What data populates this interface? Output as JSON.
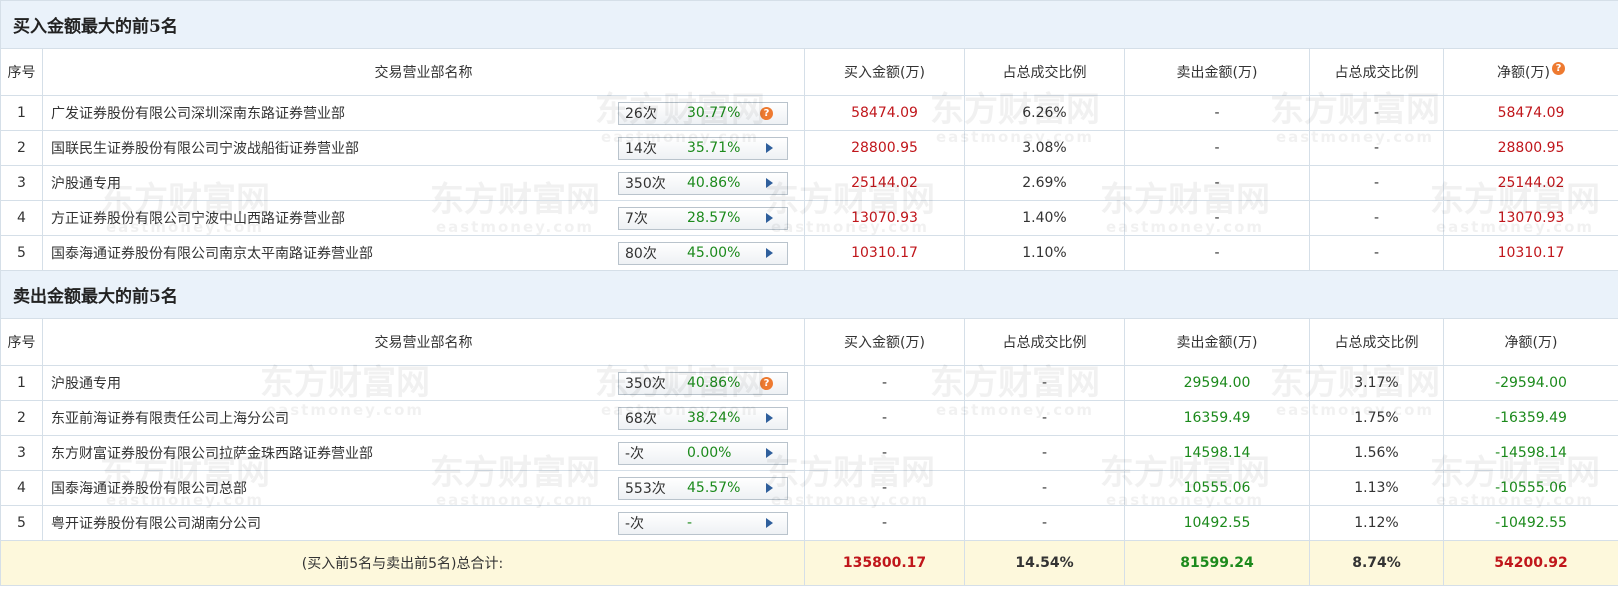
{
  "buy_section": {
    "title": "买入金额最大的前5名",
    "rows": [
      {
        "idx": "1",
        "name": "广发证券股份有限公司深圳深南东路证券营业部",
        "count": "26次",
        "pct": "30.77%",
        "buy": "58474.09",
        "buy_ratio": "6.26%",
        "sell": "-",
        "sell_ratio": "-",
        "net": "58474.09"
      },
      {
        "idx": "2",
        "name": "国联民生证券股份有限公司宁波战船街证券营业部",
        "count": "14次",
        "pct": "35.71%",
        "buy": "28800.95",
        "buy_ratio": "3.08%",
        "sell": "-",
        "sell_ratio": "-",
        "net": "28800.95"
      },
      {
        "idx": "3",
        "name": "沪股通专用",
        "count": "350次",
        "pct": "40.86%",
        "buy": "25144.02",
        "buy_ratio": "2.69%",
        "sell": "-",
        "sell_ratio": "-",
        "net": "25144.02"
      },
      {
        "idx": "4",
        "name": "方正证券股份有限公司宁波中山西路证券营业部",
        "count": "7次",
        "pct": "28.57%",
        "buy": "13070.93",
        "buy_ratio": "1.40%",
        "sell": "-",
        "sell_ratio": "-",
        "net": "13070.93"
      },
      {
        "idx": "5",
        "name": "国泰海通证券股份有限公司南京太平南路证券营业部",
        "count": "80次",
        "pct": "45.00%",
        "buy": "10310.17",
        "buy_ratio": "1.10%",
        "sell": "-",
        "sell_ratio": "-",
        "net": "10310.17"
      }
    ]
  },
  "sell_section": {
    "title": "卖出金额最大的前5名",
    "rows": [
      {
        "idx": "1",
        "name": "沪股通专用",
        "count": "350次",
        "pct": "40.86%",
        "buy": "-",
        "buy_ratio": "-",
        "sell": "29594.00",
        "sell_ratio": "3.17%",
        "net": "-29594.00"
      },
      {
        "idx": "2",
        "name": "东亚前海证券有限责任公司上海分公司",
        "count": "68次",
        "pct": "38.24%",
        "buy": "-",
        "buy_ratio": "-",
        "sell": "16359.49",
        "sell_ratio": "1.75%",
        "net": "-16359.49"
      },
      {
        "idx": "3",
        "name": "东方财富证券股份有限公司拉萨金珠西路证券营业部",
        "count": "-次",
        "pct": "0.00%",
        "buy": "-",
        "buy_ratio": "-",
        "sell": "14598.14",
        "sell_ratio": "1.56%",
        "net": "-14598.14"
      },
      {
        "idx": "4",
        "name": "国泰海通证券股份有限公司总部",
        "count": "553次",
        "pct": "45.57%",
        "buy": "-",
        "buy_ratio": "-",
        "sell": "10555.06",
        "sell_ratio": "1.13%",
        "net": "-10555.06"
      },
      {
        "idx": "5",
        "name": "粤开证券股份有限公司湖南分公司",
        "count": "-次",
        "pct": "-",
        "buy": "-",
        "buy_ratio": "-",
        "sell": "10492.55",
        "sell_ratio": "1.12%",
        "net": "-10492.55"
      }
    ]
  },
  "headers": {
    "idx": "序号",
    "name": "交易营业部名称",
    "buy": "买入金额(万)",
    "buy_ratio": "占总成交比例",
    "sell": "卖出金额(万)",
    "sell_ratio": "占总成交比例",
    "net": "净额(万)"
  },
  "help_icon_glyph": "?",
  "total": {
    "label": "(买入前5名与卖出前5名)总合计:",
    "buy": "135800.17",
    "buy_ratio": "14.54%",
    "sell": "81599.24",
    "sell_ratio": "8.74%",
    "net": "54200.92"
  },
  "watermark": {
    "cn": "东方财富网",
    "en": "eastmoney.com"
  },
  "colors": {
    "positive": "#c0161b",
    "negative": "#1c8a1c",
    "section_bg": "#eaf2fa",
    "total_bg": "#fdf8dc",
    "border": "#d5dfe8"
  }
}
